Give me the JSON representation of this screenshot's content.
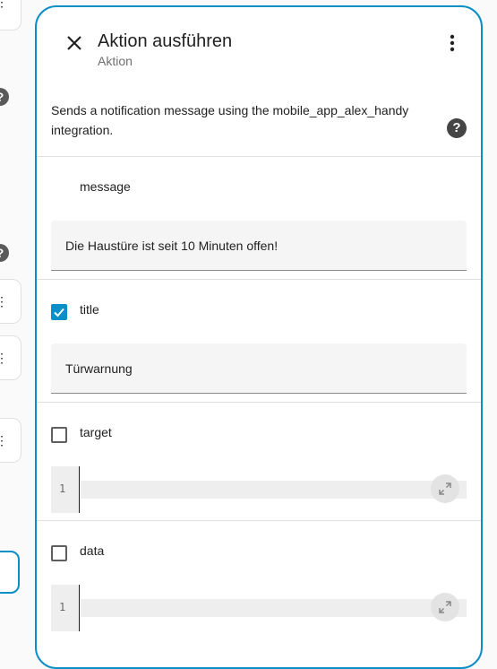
{
  "dialog": {
    "title": "Aktion ausführen",
    "subtitle": "Aktion",
    "description": "Sends a notification message using the mobile_app_alex_handy integration."
  },
  "fields": {
    "message": {
      "label": "message",
      "value": "Die Haustüre ist seit 10 Minuten offen!"
    },
    "title": {
      "label": "title",
      "value": "Türwarnung",
      "checked": true
    },
    "target": {
      "label": "target",
      "line_number": "1",
      "checked": false
    },
    "data": {
      "label": "data",
      "line_number": "1",
      "checked": false
    }
  },
  "icons": {
    "close": "close-icon",
    "menu": "more-vertical-icon",
    "help": "help-circle-icon",
    "expand": "expand-icon",
    "check": "check-icon"
  },
  "colors": {
    "accent": "#0a8fc7",
    "field_bg": "#f5f5f5",
    "text_primary": "#212121",
    "text_secondary": "#6f6f6f"
  }
}
